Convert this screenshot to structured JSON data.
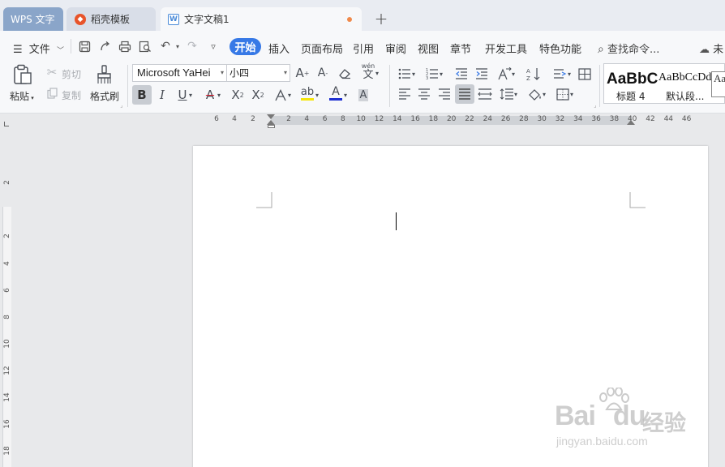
{
  "tabs": {
    "wps": "WPS 文字",
    "template": "稻壳模板",
    "document": "文字文稿1",
    "new_tab": "+"
  },
  "menu": {
    "file": "文件",
    "items": [
      "开始",
      "插入",
      "页面布局",
      "引用",
      "审阅",
      "视图",
      "章节",
      "开发工具",
      "特色功能"
    ],
    "search": "查找命令...",
    "cloud": "未"
  },
  "ribbon": {
    "paste": "粘贴",
    "cut": "剪切",
    "copy": "复制",
    "format_painter": "格式刷",
    "font_name": "Microsoft YaHei",
    "font_size": "小四",
    "pinyin": "wén",
    "styles": [
      {
        "preview": "AaBbC",
        "label": "标题 4"
      },
      {
        "preview": "AaBbCcDd",
        "label": "默认段..."
      },
      {
        "preview": "Aa",
        "label": ""
      }
    ]
  },
  "ruler": {
    "h_left": [
      "6",
      "4",
      "2"
    ],
    "h_right": [
      "2",
      "4",
      "6",
      "8",
      "10",
      "12",
      "14",
      "16",
      "18",
      "20",
      "22",
      "24",
      "26",
      "28",
      "30",
      "32",
      "34",
      "36",
      "38",
      "40",
      "42",
      "44",
      "46"
    ],
    "v": [
      "2",
      "2",
      "4",
      "6",
      "8",
      "10",
      "12",
      "14",
      "16",
      "18"
    ]
  },
  "watermark": {
    "brand": "Bai",
    "brand2": "du",
    "cn": "经验",
    "url": "jingyan.baidu.com"
  }
}
